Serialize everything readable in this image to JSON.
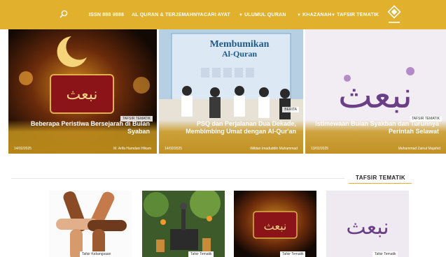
{
  "nav": {
    "items": [
      {
        "label": "TAFSIR TEMATIK",
        "dropdown": true
      },
      {
        "label": "KHAZANAH",
        "dropdown": true
      },
      {
        "label": "ULUMUL QURAN",
        "dropdown": true
      },
      {
        "label": "CARI AYAT",
        "dropdown": false
      },
      {
        "label": "AL QURAN & TERJEMAHNYA",
        "dropdown": false
      },
      {
        "label": "ISSN 888 9888",
        "dropdown": false
      }
    ]
  },
  "hero": [
    {
      "category": "TAFSIR TEMATIK",
      "title": "Beberapa Peristiwa Bersejarah di Bulan Syaban",
      "author": "M. Arifa Hamdani Hikam",
      "date": "14/02/2025"
    },
    {
      "category": "BERITA",
      "banner_line1": "Membumikan",
      "banner_line2": "Al-Quran",
      "title": "PSQ dan Perjalanan Dua Dekade, Membimbing Umat dengan Al-Qur'an",
      "author": "Wildan Imaduddin Muhammad",
      "date": "14/02/2025"
    },
    {
      "category": "TAFSIR TEMATIK",
      "title": "Istimewaan Bulan Syakban dan Turunnya Perintah Selawat",
      "author": "Muhammad Zainul Mujahid",
      "date": "13/02/2025"
    }
  ],
  "section": {
    "title": "TAFSIR TEMATIK"
  },
  "cards": [
    {
      "tag": "Tafsir Kebangsaan"
    },
    {
      "tag": "Tafsir Tematik"
    },
    {
      "tag": "Tafsir Tematik"
    },
    {
      "tag": "Tafsir Tematik"
    }
  ],
  "colors": {
    "accent": "#e1b02c",
    "nav_text": "#ffffff"
  }
}
